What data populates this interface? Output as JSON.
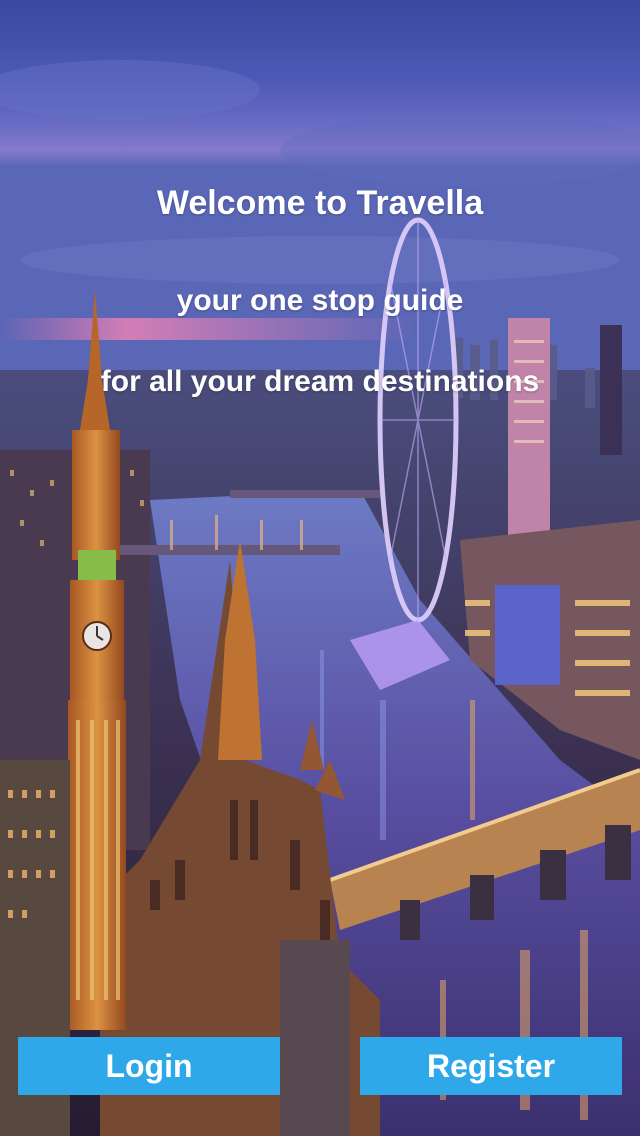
{
  "welcome": {
    "title": "Welcome to Travella",
    "subtitle_line1": "your one stop guide",
    "subtitle_line2": "for all your dream destinations"
  },
  "actions": {
    "login_label": "Login",
    "register_label": "Register"
  },
  "colors": {
    "button_background": "#2fa8ea",
    "text": "#ffffff"
  }
}
